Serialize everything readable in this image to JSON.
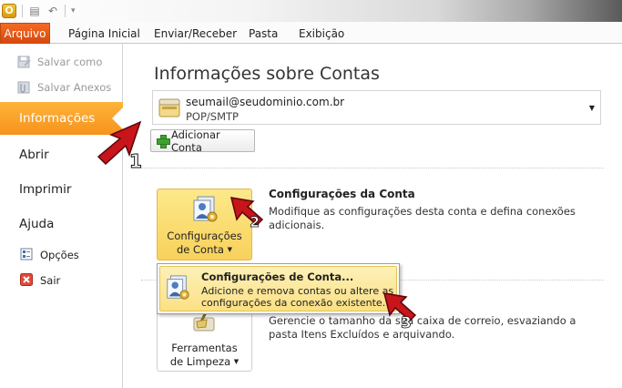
{
  "quick_access": {
    "app_letter": "O"
  },
  "ribbon": {
    "tabs": [
      {
        "label": "Arquivo"
      },
      {
        "label": "Página Inicial"
      },
      {
        "label": "Enviar/Receber"
      },
      {
        "label": "Pasta"
      },
      {
        "label": "Exibição"
      }
    ]
  },
  "backstage_nav": {
    "save_as": "Salvar como",
    "save_attachments": "Salvar Anexos",
    "info": "Informações",
    "open": "Abrir",
    "print": "Imprimir",
    "help": "Ajuda",
    "options": "Opções",
    "exit": "Sair"
  },
  "main": {
    "title": "Informações sobre Contas",
    "account": {
      "email": "seumail@seudominio.com.br",
      "type": "POP/SMTP"
    },
    "add_account_label": "Adicionar Conta",
    "account_settings": {
      "button_line1": "Configurações",
      "button_line2": "de Conta",
      "title": "Configurações da Conta",
      "description": "Modifique as configurações desta conta e defina conexões adicionais."
    },
    "dropdown": {
      "item_title": "Configurações de Conta...",
      "item_description": "Adicione e remova contas ou altere as configurações da conexão existente."
    },
    "cleanup": {
      "button_line1": "Ferramentas",
      "button_line2": "de Limpeza",
      "description": "Gerencie o tamanho da sua caixa de correio, esvaziando a pasta Itens Excluídos e arquivando."
    }
  },
  "annotations": [
    "1",
    "2",
    "3"
  ],
  "colors": {
    "file_tab": "#e2571e",
    "nav_selected": "#f8a12a",
    "active_button": "#fbdd76",
    "annotation_red": "#c8141b"
  }
}
